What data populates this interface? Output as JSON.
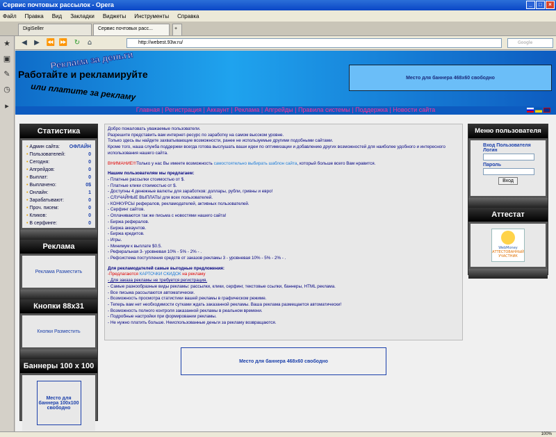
{
  "window": {
    "title": "Сервис почтовых рассылок - Opera"
  },
  "menu": [
    "Файл",
    "Правка",
    "Вид",
    "Закладки",
    "Виджеты",
    "Инструменты",
    "Справка"
  ],
  "tabs": [
    {
      "label": "DigiSeller"
    },
    {
      "label": "Сервис почтовых расс..."
    }
  ],
  "address": {
    "url": "http://webest.93w.ru/",
    "search_placeholder": "Google"
  },
  "header": {
    "logo_line1": "Реклама за деньги",
    "logo_line2": "Работайте и рекламируйте",
    "logo_line3": "или платите за рекламу",
    "banner_top": "Место для баннера 468x60 свободно"
  },
  "nav": {
    "links": [
      "Главная",
      "Регистрация",
      "Аккаунт",
      "Реклама",
      "Апгрейды",
      "Правила системы",
      "Поддержка",
      "Новости сайта"
    ]
  },
  "sidebar_left": {
    "stats_title": "Статистика",
    "stats": [
      {
        "k": "Админ сайта:",
        "v": "ОФЛАЙН"
      },
      {
        "k": "Пользователей:",
        "v": "0"
      },
      {
        "k": "Сегодня:",
        "v": "0"
      },
      {
        "k": "Апгрейдов:",
        "v": "0"
      },
      {
        "k": "Выплат:",
        "v": "0"
      },
      {
        "k": "Выплачено:",
        "v": "0$"
      },
      {
        "k": "Онлайн:",
        "v": "1"
      },
      {
        "k": "Зарабатывают:",
        "v": "0"
      },
      {
        "k": "Проч. писем:",
        "v": "0"
      },
      {
        "k": "Кликов:",
        "v": "0"
      },
      {
        "k": "В серфинге:",
        "v": "0"
      }
    ],
    "ads_title": "Реклама",
    "ads_link": "Реклама Разместить",
    "buttons_title": "Кнопки 88x31",
    "buttons_link": "Кнопки Разместить",
    "banners_title": "Баннеры 100 x 100",
    "banner_100": "Место для баннера 100x100 свободно"
  },
  "sidebar_right": {
    "menu_title": "Меню пользователя",
    "login_heading": "Вход Пользователя",
    "login_label": "Логин",
    "password_label": "Пароль",
    "login_button": "Вход",
    "attest_title": "Аттестат",
    "wm_text": "WebMoney",
    "wm_sub": "АТТЕСТОВАННЫЙ УЧАСТНИК"
  },
  "main": {
    "intro": [
      "Добро пожаловать уважаемые пользователи.",
      "Разрешите представить вам интернет-ресурс по заработку на самом высоком уровне.",
      "Только здесь вы найдете захватывающие возможности, ранее не используемые другими подобными сайтами.",
      "Кроме того, наша служба поддержки всегда готова выслушать ваши идеи по оптимизации и добавлению других возможностей для наиболее удобного и интересного использования нашего сайта."
    ],
    "attention_prefix": "ВНИМАНИЕ!!!",
    "attention_text": "Только у нас Вы имеете возможность ",
    "attention_link": "самостоятельно выбирать шаблон сайта",
    "attention_suffix": ", который больше всего Вам нравится.",
    "users_heading": "Нашим пользователям мы предлагаем:",
    "users_items": [
      "- Платные рассылки стоимостью от $.",
      "- Платные клики стоимостью от $.",
      "- Доступны 4 денежные валюты для заработков: доллары, рубли, гривны и евро!",
      "- СЛУЧАЙНЫЕ ВЫПЛАТЫ для всех пользователей.",
      "- КОНКУРСЫ рефералов, рекламодателей, активных пользователей.",
      "- Серфинг сайтов.",
      "- Оплачиваются так же письма с новостями нашего сайта!",
      "- Биржа рефералов.",
      "- Биржа аккаунтов.",
      "- Биржа кредитов.",
      "- Игры.",
      "- Минимум к выплате $0.5.",
      "- Реферальная 3- уровневая 10% - 5% - 2% - .",
      "- Рефсистема поступления средств от заказов рекламы 3 - уровневая 10% - 5% - 2% - ."
    ],
    "adv_heading": "Для рекламодателей самые выгодные предложения:",
    "adv_special_prefix": "-Предлагаются ",
    "adv_special_link": "КАРТОЧКИ СКИДОК",
    "adv_special_suffix": " на рекламу",
    "adv_items": [
      "- Для заказа рекламы не требуется регистрация.",
      "- Самые разнообразные виды рекламы: рассылки, клики, серфинг, текстовые ссылки, баннеры, HTML реклама.",
      "- Все письма рассылаются автоматически.",
      "- Возможность просмотра статистики вашей рекламы в графическом режиме.",
      "- Теперь вам нет необходимости сутками ждать заказанной рекламы. Ваша реклама размещается автоматически!",
      "- Возможность полного контроля заказанной рекламы в реальном времени.",
      "- Подробные настройки при формировании рекламы.",
      "- Не нужно платить больше. Неиспользованные деньги за рекламу возвращаются."
    ]
  },
  "banner_bottom": "Место для баннера 468x60 свободно",
  "status": {
    "zoom": "100%"
  }
}
